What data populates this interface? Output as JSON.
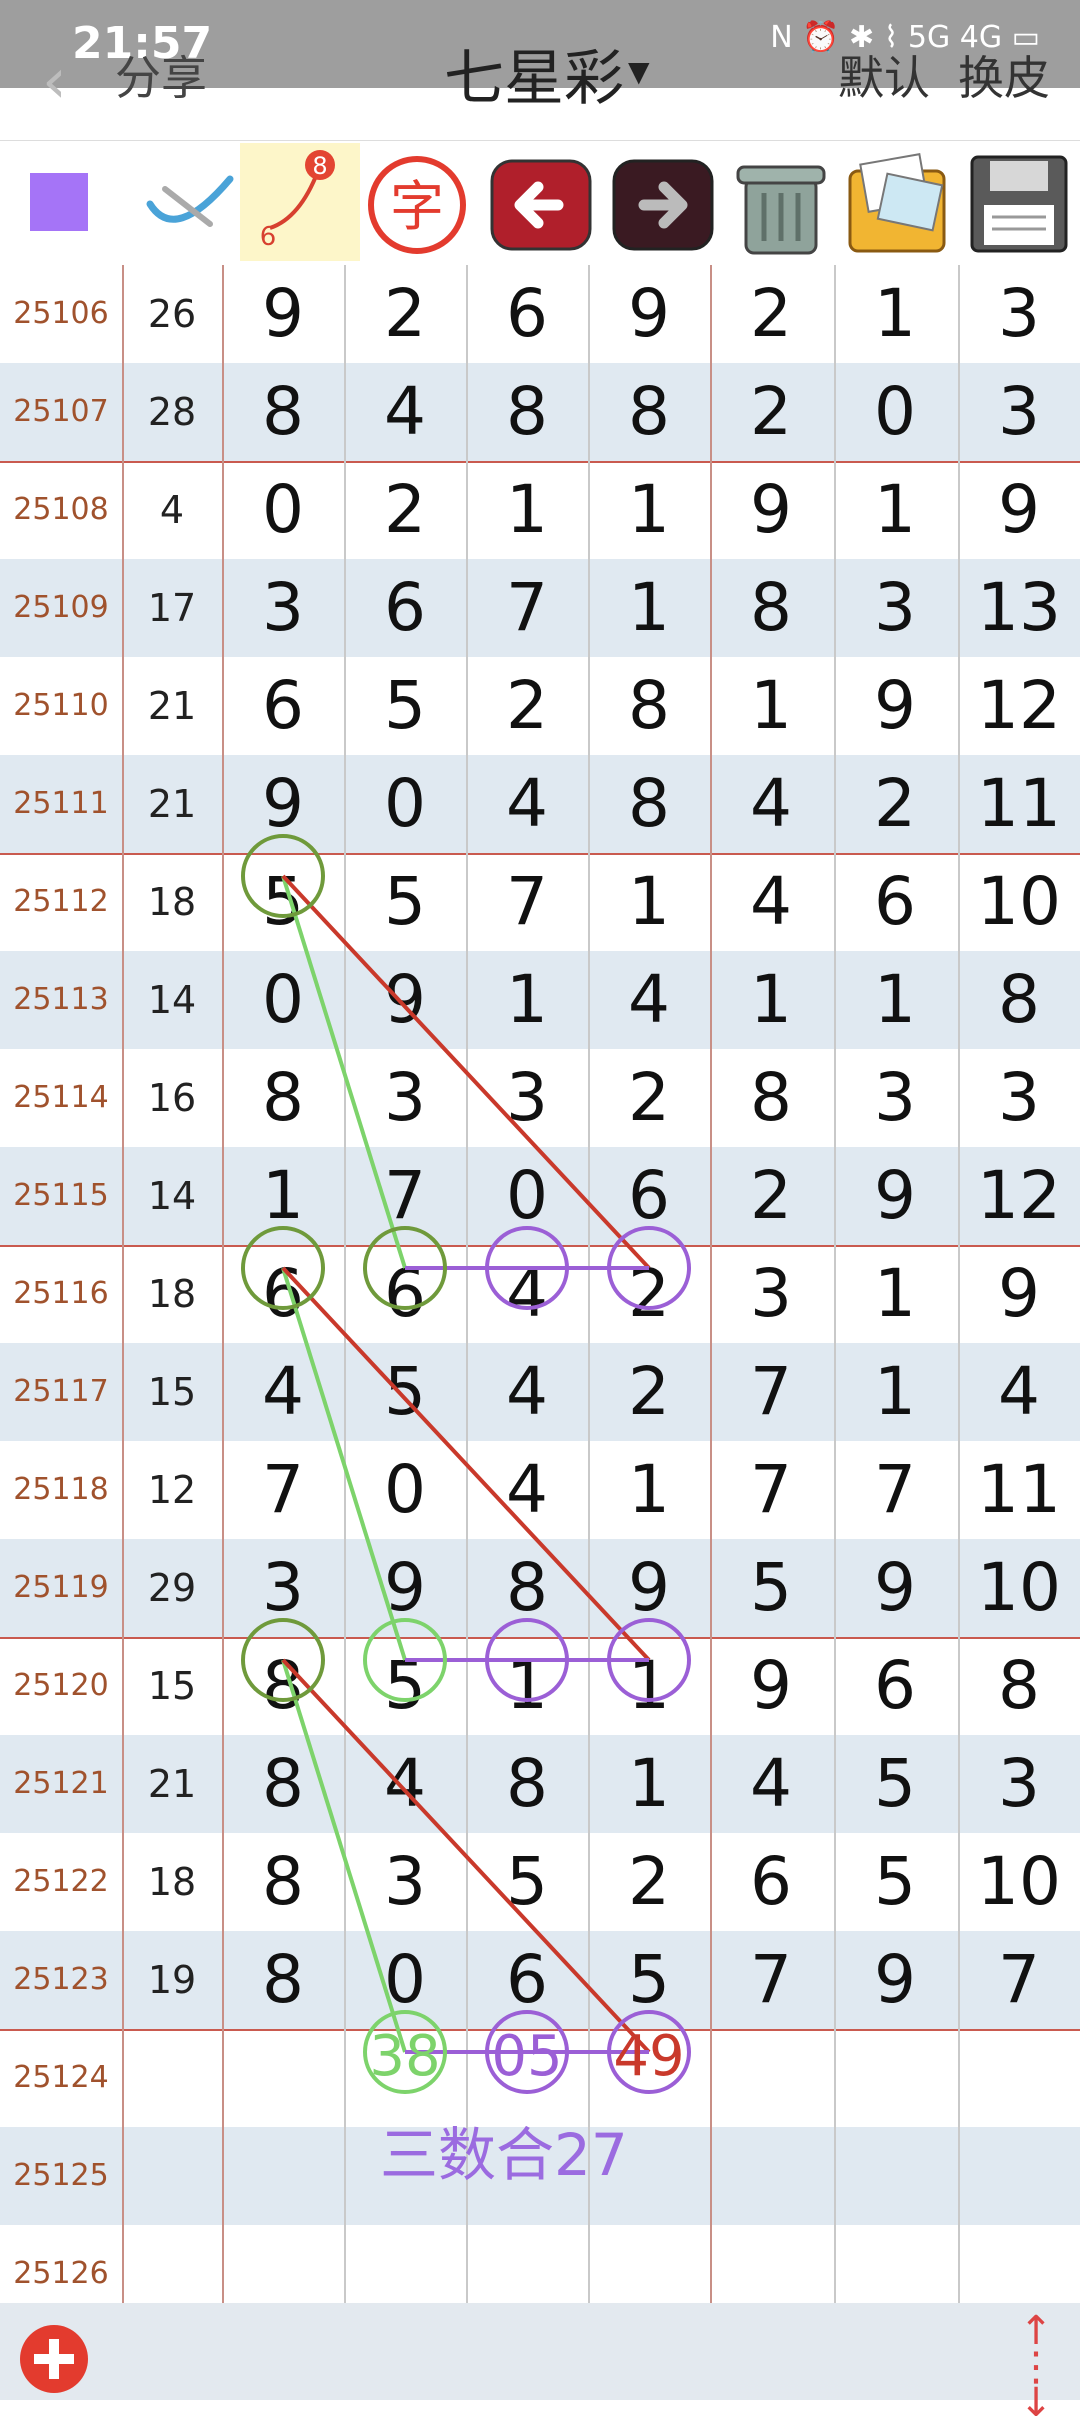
{
  "status_bar": {
    "time": "21:57",
    "right": "N ⏰ ✱ ⌇ 5G 4G ▭"
  },
  "header": {
    "share_label": "分享",
    "title": "七星彩",
    "default_label": "默认",
    "skin_label": "换皮"
  },
  "toolbar": {
    "color_swatch": "#a574f7",
    "number_badge_top": "8",
    "number_badge_bottom": "6",
    "char_tool_label": "字"
  },
  "rows": [
    {
      "issue": "25106",
      "sum": "26",
      "d": [
        "9",
        "2",
        "6",
        "9",
        "2",
        "1",
        "3"
      ]
    },
    {
      "issue": "25107",
      "sum": "28",
      "d": [
        "8",
        "4",
        "8",
        "8",
        "2",
        "0",
        "3"
      ]
    },
    {
      "issue": "25108",
      "sum": "4",
      "d": [
        "0",
        "2",
        "1",
        "1",
        "9",
        "1",
        "9"
      ]
    },
    {
      "issue": "25109",
      "sum": "17",
      "d": [
        "3",
        "6",
        "7",
        "1",
        "8",
        "3",
        "13"
      ]
    },
    {
      "issue": "25110",
      "sum": "21",
      "d": [
        "6",
        "5",
        "2",
        "8",
        "1",
        "9",
        "12"
      ]
    },
    {
      "issue": "25111",
      "sum": "21",
      "d": [
        "9",
        "0",
        "4",
        "8",
        "4",
        "2",
        "11"
      ]
    },
    {
      "issue": "25112",
      "sum": "18",
      "d": [
        "5",
        "5",
        "7",
        "1",
        "4",
        "6",
        "10"
      ]
    },
    {
      "issue": "25113",
      "sum": "14",
      "d": [
        "0",
        "9",
        "1",
        "4",
        "1",
        "1",
        "8"
      ]
    },
    {
      "issue": "25114",
      "sum": "16",
      "d": [
        "8",
        "3",
        "3",
        "2",
        "8",
        "3",
        "3"
      ]
    },
    {
      "issue": "25115",
      "sum": "14",
      "d": [
        "1",
        "7",
        "0",
        "6",
        "2",
        "9",
        "12"
      ]
    },
    {
      "issue": "25116",
      "sum": "18",
      "d": [
        "6",
        "6",
        "4",
        "2",
        "3",
        "1",
        "9"
      ]
    },
    {
      "issue": "25117",
      "sum": "15",
      "d": [
        "4",
        "5",
        "4",
        "2",
        "7",
        "1",
        "4"
      ]
    },
    {
      "issue": "25118",
      "sum": "12",
      "d": [
        "7",
        "0",
        "4",
        "1",
        "7",
        "7",
        "11"
      ]
    },
    {
      "issue": "25119",
      "sum": "29",
      "d": [
        "3",
        "9",
        "8",
        "9",
        "5",
        "9",
        "10"
      ]
    },
    {
      "issue": "25120",
      "sum": "15",
      "d": [
        "8",
        "5",
        "1",
        "1",
        "9",
        "6",
        "8"
      ]
    },
    {
      "issue": "25121",
      "sum": "21",
      "d": [
        "8",
        "4",
        "8",
        "1",
        "4",
        "5",
        "3"
      ]
    },
    {
      "issue": "25122",
      "sum": "18",
      "d": [
        "8",
        "3",
        "5",
        "2",
        "6",
        "5",
        "10"
      ]
    },
    {
      "issue": "25123",
      "sum": "19",
      "d": [
        "8",
        "0",
        "6",
        "5",
        "7",
        "9",
        "7"
      ]
    },
    {
      "issue": "25124",
      "sum": "",
      "d": [
        "",
        "",
        "",
        "",
        "",
        "",
        ""
      ]
    },
    {
      "issue": "25125",
      "sum": "",
      "d": [
        "",
        "",
        "",
        "",
        "",
        "",
        ""
      ]
    },
    {
      "issue": "25126",
      "sum": "",
      "d": [
        "",
        "",
        "",
        "",
        "",
        "",
        ""
      ]
    }
  ],
  "predictions": {
    "col1": "38",
    "col2": "05",
    "col3": "49"
  },
  "note": "三数合27",
  "colors": {
    "green_line": "#7dd36b",
    "red_line": "#c9392b",
    "purple_circle": "#9b5fd6",
    "olive_circle": "#6f9a3b"
  }
}
